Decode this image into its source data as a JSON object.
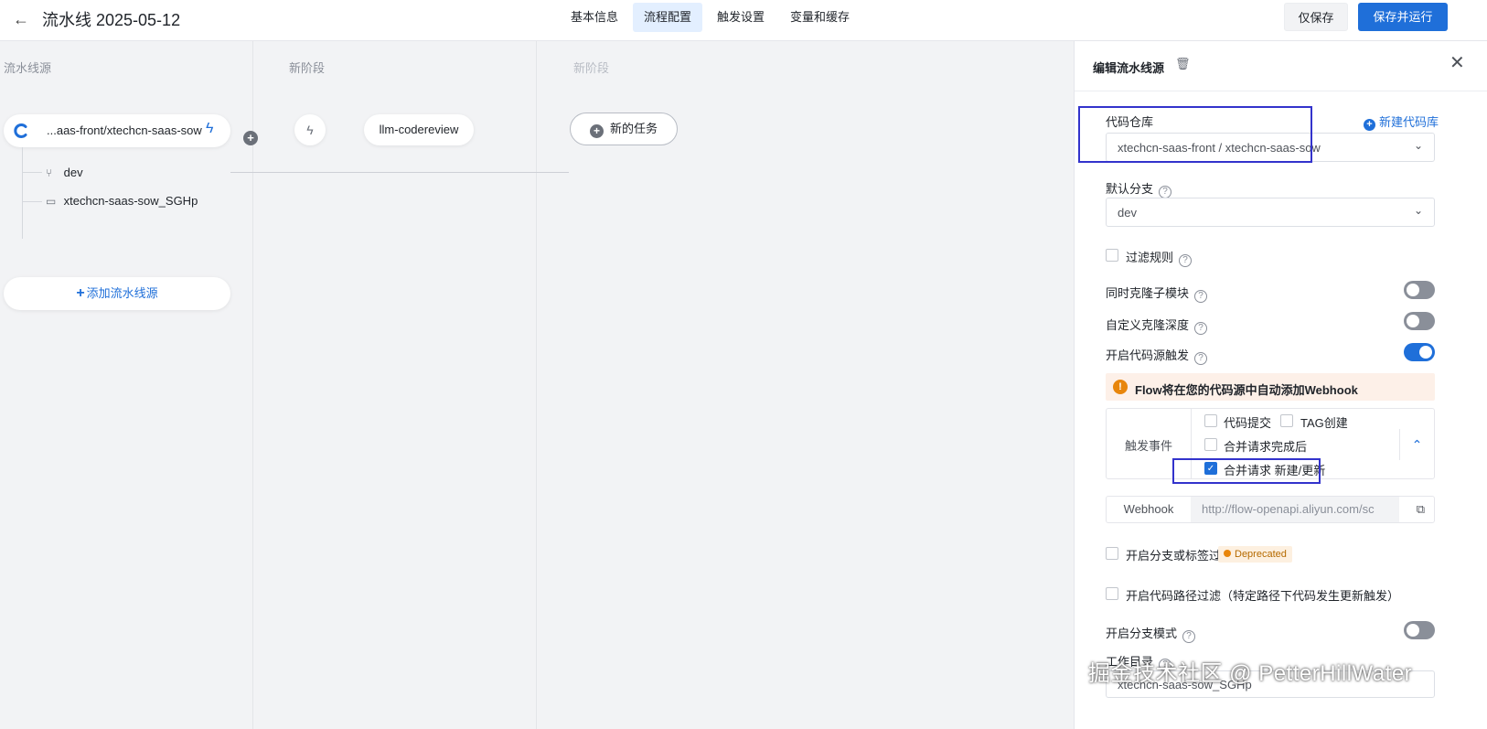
{
  "header": {
    "back_icon": "arrow-left-icon",
    "title": "流水线 2025-05-12",
    "tabs": [
      "基本信息",
      "流程配置",
      "触发设置",
      "变量和缓存"
    ],
    "active_tab": "流程配置",
    "save_only_label": "仅保存",
    "save_run_label": "保存并运行"
  },
  "canvas": {
    "stages": [
      "流水线源",
      "新阶段",
      "新阶段"
    ],
    "source": {
      "name": "...aas-front/xtechcn-saas-sow",
      "branch": "dev",
      "path": "xtechcn-saas-sow_SGHp"
    },
    "add_source_label": "添加流水线源",
    "task_name": "llm-codereview",
    "new_task_label": "新的任务"
  },
  "panel": {
    "title": "编辑流水线源",
    "repo_label": "代码仓库",
    "new_repo_label": "新建代码库",
    "repo_value": "xtechcn-saas-front / xtechcn-saas-sow",
    "branch_label": "默认分支",
    "branch_value": "dev",
    "filter_rule_label": "过滤规则",
    "clone_submodule_label": "同时克隆子模块",
    "clone_submodule_on": false,
    "custom_depth_label": "自定义克隆深度",
    "custom_depth_on": false,
    "trigger_label": "开启代码源触发",
    "trigger_on": true,
    "notice_text": "Flow将在您的代码源中自动添加Webhook",
    "event_label": "触发事件",
    "events": [
      {
        "label": "代码提交",
        "checked": false
      },
      {
        "label": "TAG创建",
        "checked": false
      },
      {
        "label": "合并请求完成后",
        "checked": false
      },
      {
        "label": "合并请求 新建/更新",
        "checked": true
      }
    ],
    "webhook_label": "Webhook",
    "webhook_value": "http://flow-openapi.aliyun.com/sc",
    "branch_filter_label": "开启分支或标签过滤",
    "deprecated_badge": "Deprecated",
    "path_filter_label": "开启代码路径过滤（特定路径下代码发生更新触发）",
    "branch_mode_label": "开启分支模式",
    "branch_mode_on": false,
    "work_dir_label": "工作目录",
    "work_dir_value": "xtechcn-saas-sow_SGHp"
  },
  "watermark": "掘金技术社区 @ PetterHillWater",
  "colors": {
    "accent": "#1f6fd9",
    "highlight_box": "#3333cc",
    "notice_bg": "#fdf0e8",
    "warn": "#e8860c"
  }
}
